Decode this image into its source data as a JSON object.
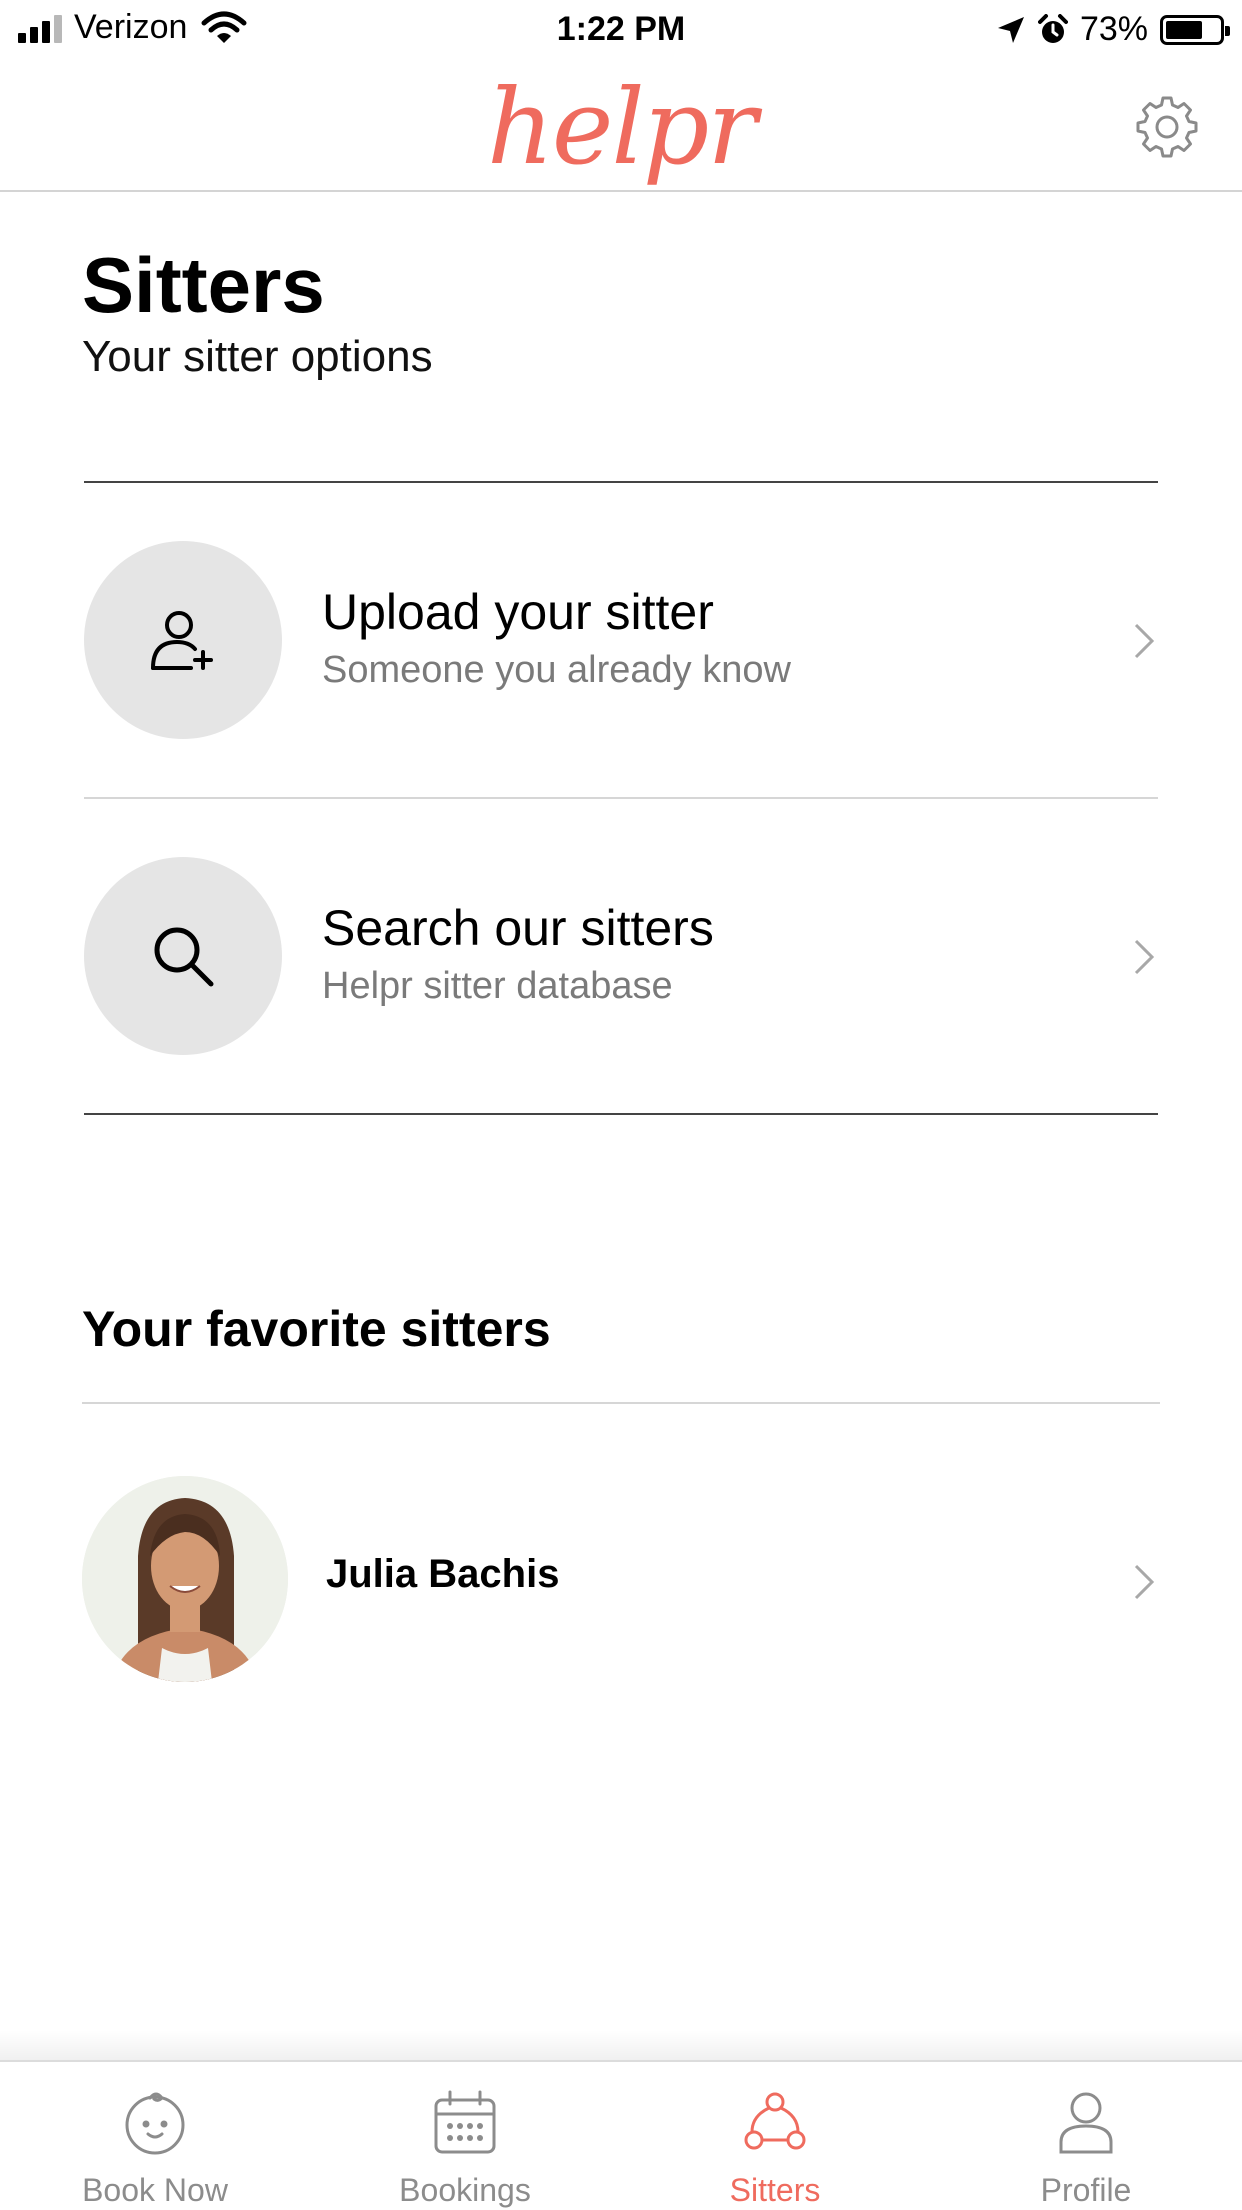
{
  "status_bar": {
    "carrier": "Verizon",
    "time": "1:22 PM",
    "battery_percent": "73%",
    "signal_bars_filled": 3,
    "signal_bars_total": 4,
    "battery_level": 0.73
  },
  "header": {
    "logo_text": "helpr",
    "settings_icon": "gear-icon",
    "brand_color": "#ef6b5e"
  },
  "page": {
    "title": "Sitters",
    "subtitle": "Your sitter options"
  },
  "options": [
    {
      "title": "Upload your sitter",
      "subtitle": "Someone you already know",
      "icon": "add-user-icon"
    },
    {
      "title": "Search our sitters",
      "subtitle": "Helpr sitter database",
      "icon": "search-icon"
    }
  ],
  "favorites": {
    "heading": "Your favorite sitters",
    "items": [
      {
        "name": "Julia Bachis",
        "icon": "avatar"
      }
    ]
  },
  "tabbar": {
    "active": "Sitters",
    "tabs": [
      {
        "label": "Book Now",
        "icon": "baby-face-icon"
      },
      {
        "label": "Bookings",
        "icon": "calendar-icon"
      },
      {
        "label": "Sitters",
        "icon": "sitters-network-icon"
      },
      {
        "label": "Profile",
        "icon": "person-icon"
      }
    ]
  }
}
